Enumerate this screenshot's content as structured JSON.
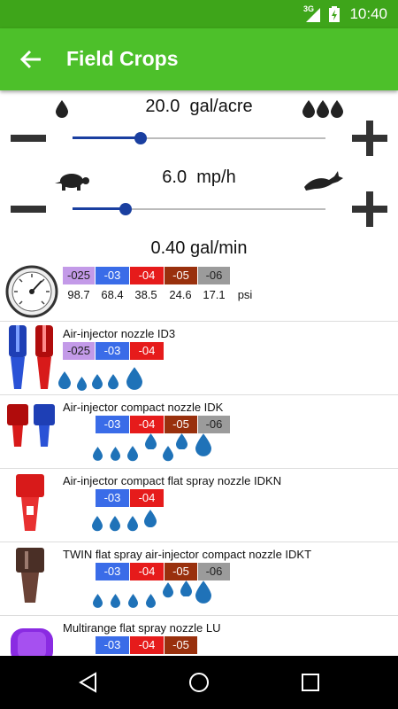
{
  "status": {
    "network": "3G",
    "time": "10:40"
  },
  "appbar": {
    "title": "Field Crops"
  },
  "rate": {
    "value": "20.0",
    "unit": "gal/acre",
    "fraction": 0.27
  },
  "speed": {
    "value": "6.0",
    "unit": "mp/h",
    "fraction": 0.21
  },
  "flow": {
    "value": "0.40",
    "unit": "gal/min"
  },
  "pressure_table": {
    "sizes": [
      "-025",
      "-03",
      "-04",
      "-05",
      "-06"
    ],
    "values": [
      "98.7",
      "68.4",
      "38.5",
      "24.6",
      "17.1"
    ],
    "unit": "psi"
  },
  "nozzles": [
    {
      "name": "Air-injector nozzle ID3",
      "sizes": [
        "-025",
        "-03",
        "-04"
      ]
    },
    {
      "name": "Air-injector compact nozzle IDK",
      "sizes": [
        "-03",
        "-04",
        "-05",
        "-06"
      ]
    },
    {
      "name": "Air-injector compact flat spray nozzle IDKN",
      "sizes": [
        "-03",
        "-04"
      ]
    },
    {
      "name": "TWIN flat spray air-injector compact nozzle IDKT",
      "sizes": [
        "-03",
        "-04",
        "-05",
        "-06"
      ]
    },
    {
      "name": "Multirange flat spray nozzle LU",
      "sizes": [
        "-03",
        "-04",
        "-05"
      ]
    }
  ],
  "colors": {
    "statusbar": "#3ea51a",
    "appbar": "#4dc02a",
    "slider": "#1a3fa0",
    "drop": "#1f72b8"
  },
  "icons": [
    "drop-icon",
    "drops-icon",
    "turtle-icon",
    "rabbit-icon",
    "gauge-icon",
    "back-arrow-icon"
  ]
}
